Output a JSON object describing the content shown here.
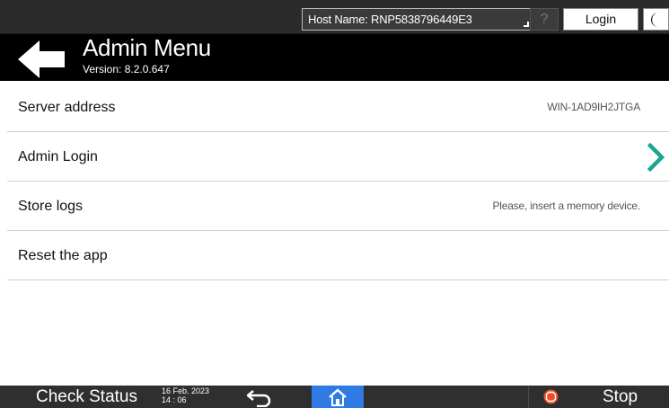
{
  "top_bar": {
    "host_name": "Host Name: RNP5838796449E3",
    "help_symbol": "?",
    "login_label": "Login",
    "moon_icon": "moon-icon"
  },
  "header": {
    "title": "Admin Menu",
    "version": "Version: 8.2.0.647",
    "back_icon": "arrow-left-icon"
  },
  "menu": {
    "items": [
      {
        "label": "Server address",
        "value": "WIN-1AD9IH2JTGA"
      },
      {
        "label": "Admin Login",
        "value": "",
        "chevron_color": "#1aa58f"
      },
      {
        "label": "Store logs",
        "value": "Please, insert a memory device."
      },
      {
        "label": "Reset the app",
        "value": ""
      }
    ]
  },
  "bottom_bar": {
    "check_status": "Check Status",
    "date": "16 Feb. 2023",
    "time": "14 : 06",
    "back_icon": "return-arrow-icon",
    "home_icon": "home-icon",
    "home_color": "#2f7ae5",
    "stop_icon": "stop-icon",
    "stop_color": "#e8502a",
    "stop_label": "Stop"
  }
}
